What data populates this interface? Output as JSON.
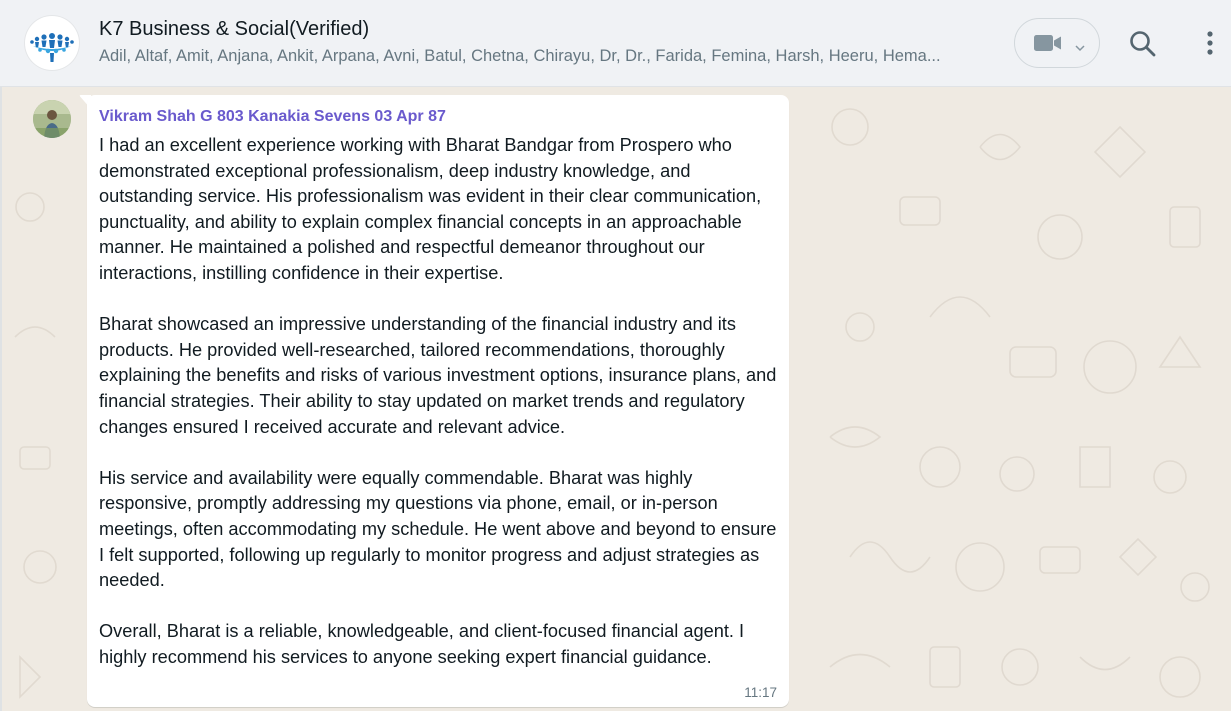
{
  "header": {
    "title": "K7 Business & Social(Verified)",
    "members": "Adil, Altaf, Amit, Anjana, Ankit, Arpana, Avni, Batul, Chetna, Chirayu, Dr, Dr., Farida, Femina, Harsh, Heeru, Hema...",
    "icons": {
      "avatar": "group-logo-icon",
      "video": "video-camera-icon",
      "dropdown": "chevron-down-icon",
      "search": "search-icon",
      "menu": "more-vertical-icon"
    }
  },
  "message": {
    "sender": "Vikram Shah G 803 Kanakia Sevens 03 Apr 87",
    "paragraphs": [
      "I had an excellent experience working with Bharat Bandgar from Prospero who demonstrated exceptional professionalism, deep industry knowledge, and outstanding service. His professionalism was evident in their clear communication, punctuality, and ability to explain complex financial concepts in an approachable manner. He maintained a polished and respectful demeanor throughout our interactions, instilling confidence in their expertise.",
      "Bharat showcased an impressive understanding of the financial industry and its products. He provided well-researched, tailored recommendations, thoroughly explaining the benefits and risks of various investment options, insurance plans, and financial strategies. Their ability to stay updated on market trends and regulatory changes ensured I received accurate and relevant advice.",
      "His service and availability were equally commendable. Bharat was highly responsive, promptly addressing my questions via phone, email, or in-person meetings, often accommodating my schedule. He went above and beyond to ensure I felt supported, following up regularly to monitor progress and adjust strategies as needed.",
      "Overall, Bharat is a reliable, knowledgeable, and client-focused financial agent. I highly recommend his services to anyone seeking expert financial guidance."
    ],
    "time": "11:17"
  },
  "colors": {
    "header_bg": "#f0f2f5",
    "chat_bg": "#efeae2",
    "bubble_bg": "#ffffff",
    "sender_name": "#6a5acd",
    "secondary_text": "#667781"
  }
}
